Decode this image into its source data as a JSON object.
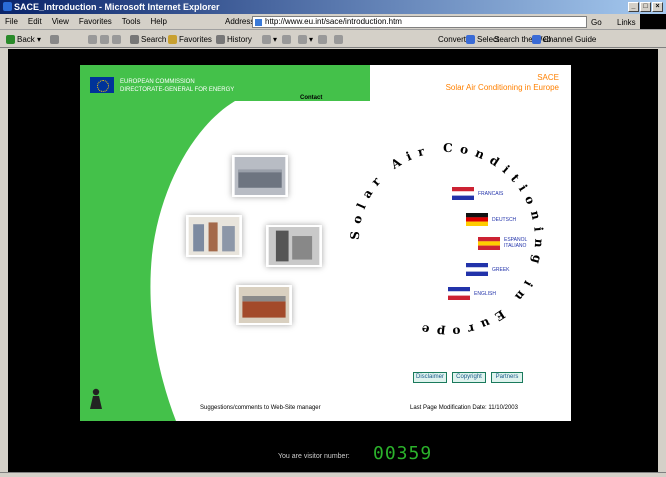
{
  "window": {
    "title": "SACE_Introduction - Microsoft Internet Explorer"
  },
  "menu": [
    "File",
    "Edit",
    "View",
    "Favorites",
    "Tools",
    "Help"
  ],
  "address": {
    "label": "Address",
    "url": "http://www.eu.int/sace/introduction.htm",
    "go": "Go",
    "links": "Links"
  },
  "toolbar": {
    "back": "Back",
    "search": "Search",
    "favorites": "Favorites",
    "history": "History",
    "right1": "Convert",
    "right2": "Select",
    "right3": "Search the Web",
    "right4": "Channel Guide"
  },
  "header": {
    "eu_line1": "EUROPEAN COMMISSION",
    "eu_line2": "DIRECTORATE-GENERAL FOR ENERGY",
    "contact": "Contact",
    "site_title": "SACE",
    "site_subtitle": "Solar Air Conditioning in Europe"
  },
  "ring_text": "Solar Air Conditioning in Europe",
  "languages": [
    {
      "label": "FRANCAIS",
      "colors": [
        "#cc2233",
        "#ffffff",
        "#2233aa"
      ]
    },
    {
      "label": "DEUTSCH",
      "colors": [
        "#111111",
        "#dd0000",
        "#ffcc00"
      ]
    },
    {
      "label": "ESPANOL ITALIANO",
      "colors": [
        "#cc2233",
        "#ffcc00",
        "#cc2233"
      ]
    },
    {
      "label": "GREEK",
      "colors": [
        "#2233aa",
        "#ffffff",
        "#2233aa"
      ]
    },
    {
      "label": "ENGLISH",
      "colors": [
        "#2233aa",
        "#ffffff",
        "#cc2233"
      ]
    }
  ],
  "nav_buttons": [
    "Disclaimer",
    "Copyright",
    "Partners"
  ],
  "footer": {
    "suggestions": "Suggestions/comments to Web-Site manager",
    "last_update": "Last Page Modification Date: 11/10/2003"
  },
  "visitors": {
    "label": "You are visitor number:",
    "count": "00359"
  },
  "colors": {
    "green": "#44c14a",
    "accent": "#ff8000",
    "counter": "#2bb22b"
  }
}
